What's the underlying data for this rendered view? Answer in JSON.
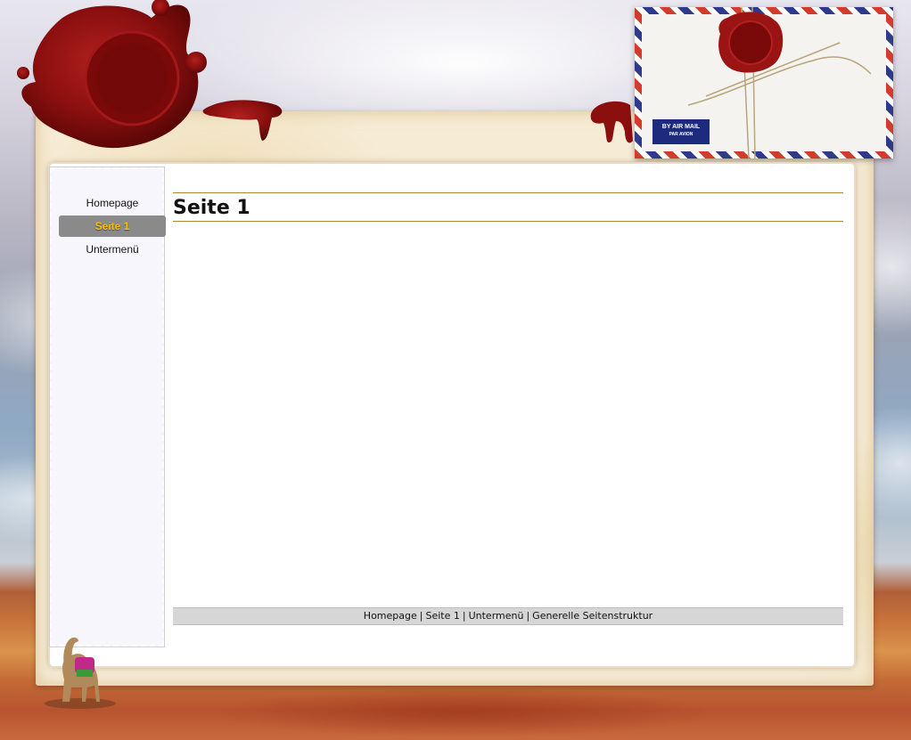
{
  "nav": {
    "items": [
      {
        "label": "Homepage",
        "active": false
      },
      {
        "label": "Seite 1",
        "active": true
      },
      {
        "label": "Untermenü",
        "active": false
      }
    ]
  },
  "main": {
    "title": "Seite 1"
  },
  "footer": {
    "links": [
      "Homepage",
      "Seite 1",
      "Untermenü",
      "Generelle Seitenstruktur"
    ],
    "separator": "|"
  },
  "envelope": {
    "label_line1": "BY AIR MAIL",
    "label_line2": "PAR AVION"
  },
  "colors": {
    "active_bg": "#8a8a8a",
    "active_text": "#f2c200",
    "rule": "#a98a2c",
    "wax": "#8b0f0f",
    "paper": "#f6ecd6"
  }
}
